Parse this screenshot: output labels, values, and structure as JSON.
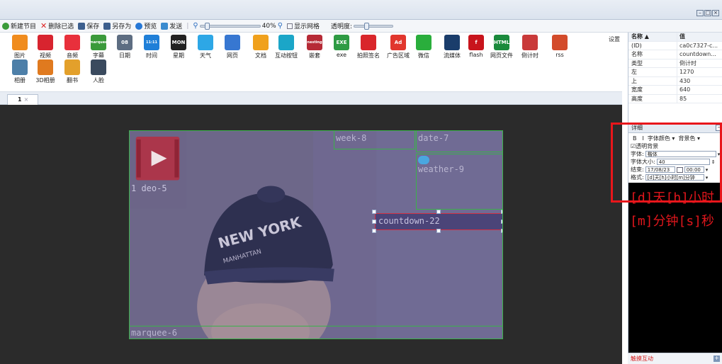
{
  "window": {
    "controls": [
      "–",
      "□",
      "×"
    ]
  },
  "toolbar": {
    "new_program": "新建节目",
    "delete_selected": "删除已选",
    "save": "保存",
    "save_as": "另存为",
    "preview": "预览",
    "send": "发送",
    "zoom": "40%",
    "show_grid": "显示网格",
    "transparency": "透明度:"
  },
  "ribbon": {
    "items": [
      {
        "label": "图片",
        "icon": "picture-icon",
        "color": "#f08c1e"
      },
      {
        "label": "视频",
        "icon": "video-icon",
        "color": "#d8242f"
      },
      {
        "label": "音频",
        "icon": "audio-icon",
        "color": "#e8303c"
      },
      {
        "label": "字幕",
        "icon": "marquee-icon",
        "color": "#3b9a3b",
        "text": "marquee"
      },
      {
        "label": "日期",
        "icon": "date-icon",
        "color": "#5d6d82",
        "text": "08"
      },
      {
        "label": "时间",
        "icon": "time-icon",
        "color": "#1f7fd8",
        "text": "11:11"
      },
      {
        "label": "星期",
        "icon": "week-icon",
        "color": "#222222",
        "text": "MON"
      },
      {
        "label": "天气",
        "icon": "weather-icon",
        "color": "#2da7e6"
      },
      {
        "label": "网页",
        "icon": "webpage-icon",
        "color": "#3777d1"
      },
      {
        "label": "文档",
        "icon": "document-icon",
        "color": "#f0a11d"
      },
      {
        "label": "互动按钮",
        "icon": "interactive-button-icon",
        "color": "#1ba6c8"
      },
      {
        "label": "嵌套",
        "icon": "nesting-icon",
        "color": "#b62a36",
        "text": "nesting"
      },
      {
        "label": "exe",
        "icon": "exe-icon",
        "color": "#2e9b44",
        "text": "EXE"
      },
      {
        "label": "拍照签名",
        "icon": "photo-sign-icon",
        "color": "#d9262b"
      },
      {
        "label": "广告区域",
        "icon": "ad-area-icon",
        "color": "#e1362d",
        "text": "Ad"
      },
      {
        "label": "微信",
        "icon": "wechat-icon",
        "color": "#2aae3c"
      },
      {
        "label": "流媒体",
        "icon": "streaming-icon",
        "color": "#1a3d6b"
      },
      {
        "label": "flash",
        "icon": "flash-icon",
        "color": "#c8141c",
        "text": "f"
      },
      {
        "label": "网页文件",
        "icon": "html-file-icon",
        "color": "#1a8a3c",
        "text": "HTML"
      },
      {
        "label": "倒计时",
        "icon": "countdown-icon",
        "color": "#c93a3a"
      },
      {
        "label": "rss",
        "icon": "rss-icon",
        "color": "#d34b2b"
      },
      {
        "label": "相册",
        "icon": "album-icon",
        "color": "#4d7fa8"
      },
      {
        "label": "3D相册",
        "icon": "3d-album-icon",
        "color": "#e07a1f"
      },
      {
        "label": "翻书",
        "icon": "flip-book-icon",
        "color": "#e3a02b"
      },
      {
        "label": "人脸",
        "icon": "face-icon",
        "color": "#3a4a5e"
      }
    ],
    "settings": "设置"
  },
  "tabs": [
    {
      "label": "1"
    }
  ],
  "stage": {
    "widgets": [
      {
        "label": "week-8"
      },
      {
        "label": "date-7"
      },
      {
        "label": "weather-9"
      },
      {
        "label": "countdown-22"
      },
      {
        "label": "1 deo-5"
      },
      {
        "label": "marquee-6"
      }
    ],
    "photo_text": "NEW YORK",
    "photo_subtext": "MANHATTAN"
  },
  "properties": {
    "header": {
      "name": "名称 ▲",
      "value": "值"
    },
    "rows": [
      {
        "k": "(ID)",
        "v": "ca0c7327-c..."
      },
      {
        "k": "名称",
        "v": "countdown..."
      },
      {
        "k": "类型",
        "v": "倒计时"
      },
      {
        "k": "左",
        "v": "1270"
      },
      {
        "k": "上",
        "v": "430"
      },
      {
        "k": "宽度",
        "v": "640"
      },
      {
        "k": "高度",
        "v": "85"
      }
    ]
  },
  "detail": {
    "title": "详细",
    "bold": "B",
    "italic": "I",
    "font_color": "字体颜色 ▾",
    "bg_color": "背景色 ▾",
    "transparent_bg": "☑透明背景",
    "font_label": "字体:",
    "font_value": "楷体",
    "size_label": "字体大小:",
    "size_value": "40",
    "end_label": "结束:",
    "end_date": "17/08/23",
    "end_time": "00:00",
    "format_label": "格式:",
    "format_value": "[d]天[h]小时[m]分钟",
    "preview_text": "[d]天[h]小时[m]分钟[s]秒"
  },
  "bottom": {
    "label": "触摸互动"
  }
}
